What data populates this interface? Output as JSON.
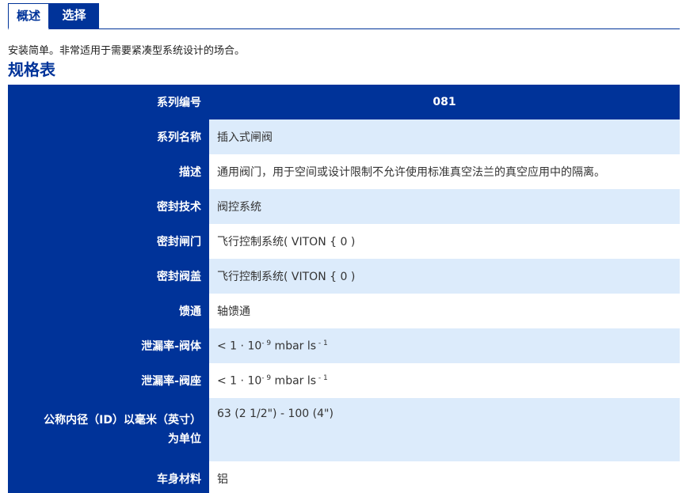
{
  "tabs": [
    {
      "label": "概述",
      "active": true
    },
    {
      "label": "选择",
      "active": false
    }
  ],
  "intro": "安装简单。非常适用于需要紧凑型系统设计的场合。",
  "spec_title": "规格表",
  "colors": {
    "brand_blue": "#003399",
    "row_light_blue": "#dcebfb",
    "white": "#ffffff"
  },
  "table": {
    "rows": [
      {
        "label": "系列编号",
        "value": "081"
      },
      {
        "label": "系列名称",
        "value": "插入式闸阀"
      },
      {
        "label": "描述",
        "value": "通用阀门，用于空间或设计限制不允许使用标准真空法兰的真空应用中的隔离。"
      },
      {
        "label": "密封技术",
        "value": "阀控系统"
      },
      {
        "label": "密封闸门",
        "value": "飞行控制系统( VITON { 0 )"
      },
      {
        "label": "密封阀盖",
        "value": "飞行控制系统( VITON { 0 )"
      },
      {
        "label": "馈通",
        "value": "轴馈通"
      },
      {
        "label": "泄漏率-阀体",
        "value_prefix": "< 1 · 10",
        "value_exp1": "- 9",
        "value_mid": " mbar ls",
        "value_exp2": " - 1"
      },
      {
        "label": "泄漏率-阀座",
        "value_prefix": "< 1 · 10",
        "value_exp1": "- 9",
        "value_mid": " mbar ls",
        "value_exp2": " - 1"
      },
      {
        "label_line1": "公称内径（ID）以毫米（英寸）",
        "label_line2": "为单位",
        "value": "63 (2 1/2\") - 100 (4\")"
      },
      {
        "label": "车身材料",
        "value": "铝"
      }
    ]
  }
}
